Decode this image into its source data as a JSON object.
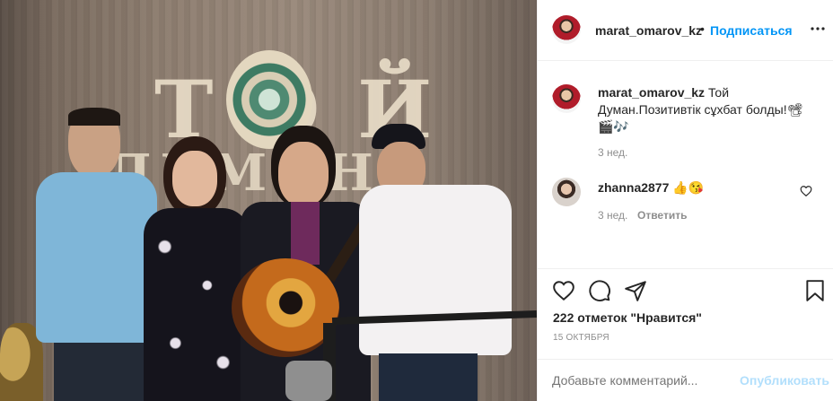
{
  "post": {
    "owner_username": "marat_omarov_kz",
    "follow_label": "Подписаться",
    "more_icon": "more-icon",
    "caption_text": "Той Думан.Позитивтік сұхбат болды!📽 🎬🎶",
    "caption_time": "3 нед.",
    "likes_text": "222 отметок \"Нравится\"",
    "date_text": "15 ОКТЯБРЯ",
    "comment_placeholder": "Добавьте комментарий...",
    "publish_label": "Опубликовать"
  },
  "comments": [
    {
      "username": "zhanna2877",
      "text": "👍😘",
      "time": "3 нед.",
      "reply_label": "Ответить"
    }
  ],
  "photo": {
    "sign_text_top": "ТОЙ",
    "sign_text_bottom": "ДУМАН"
  },
  "colors": {
    "accent": "#0095f6",
    "text": "#262626",
    "muted": "#8e8e8e",
    "border": "#efefef"
  }
}
